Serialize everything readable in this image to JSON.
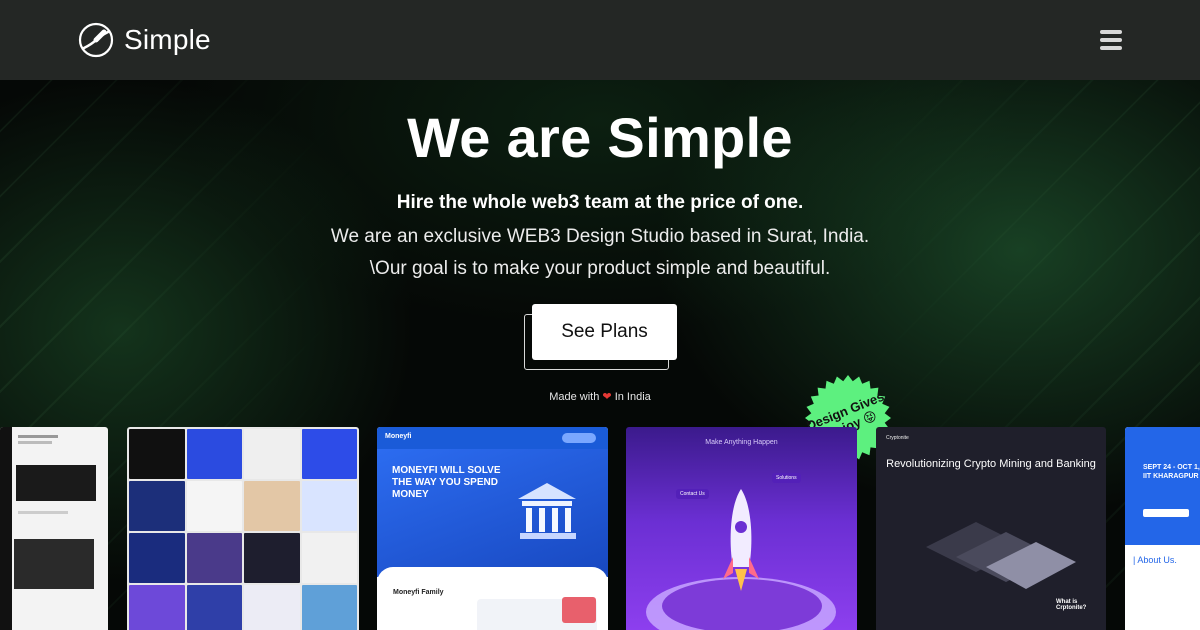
{
  "brand": {
    "name": "Simple",
    "icon": "logo-circle-icon"
  },
  "header": {
    "menu_icon": "hamburger-menu-icon"
  },
  "hero": {
    "title": "We are Simple",
    "tagline": "Hire the whole web3 team at the price of one.",
    "line1": "We are an exclusive WEB3 Design Studio based in Surat, India.",
    "line2": "\\Our goal is to make your product simple and beautiful.",
    "cta_label": "See Plans",
    "made_with_prefix": "Made with",
    "made_with_suffix": "In India",
    "heart_icon": "heart-icon"
  },
  "badge": {
    "text": "Design Gives us joy 😝",
    "color": "#5df07f"
  },
  "gallery": {
    "card3": {
      "brand": "Moneyfi",
      "headline": "MONEYFI WILL SOLVE THE WAY YOU SPEND MONEY",
      "section": "Moneyfi Family"
    },
    "card4": {
      "headline": "Make Anything Happen",
      "chip1": "Solutions",
      "chip2": "Contact Us"
    },
    "card5": {
      "brand": "Cryptonite",
      "headline": "Revolutionizing Crypto Mining and Banking",
      "sub": "What is Crptonite?"
    },
    "card6": {
      "headline": "SEPT 24 - OCT 1, IIT KHARAGPUR",
      "section": "| About Us."
    }
  },
  "colors": {
    "header_bg": "#242725",
    "accent_green": "#5df07f",
    "cta_bg": "#ffffff"
  }
}
